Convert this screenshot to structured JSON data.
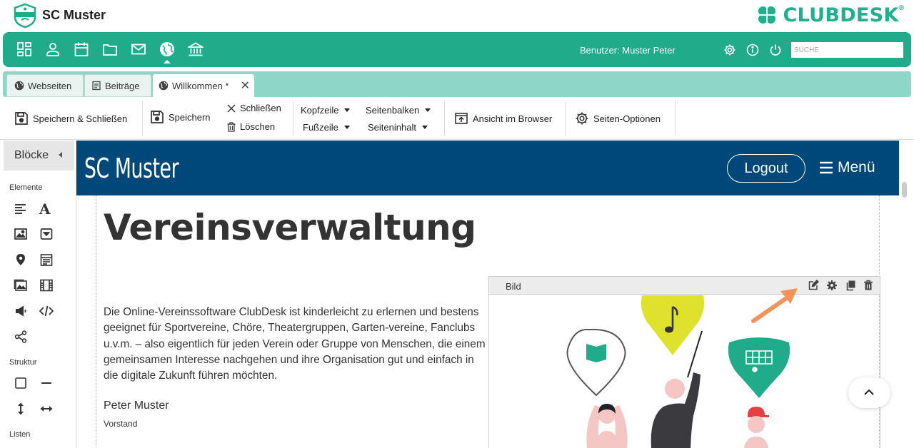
{
  "app": {
    "club_name": "SC Muster",
    "logo_text": "SC MUSTER",
    "brand_name": "CLUBDESK",
    "brand_reg": "®",
    "brand_color": "#20b08e"
  },
  "navbar": {
    "color": "#20ac8a",
    "icons": [
      "dashboard-icon",
      "person-icon",
      "calendar-icon",
      "folder-icon",
      "mail-icon",
      "globe-icon",
      "bank-icon"
    ],
    "active_icon": "globe-icon",
    "user_label": "Benutzer: Muster Peter",
    "right_icons": [
      "gear-icon",
      "info-icon",
      "power-icon"
    ],
    "search_placeholder": "SUCHE"
  },
  "tabs": [
    {
      "label": "Webseiten",
      "icon": "globe-icon",
      "active": false
    },
    {
      "label": "Beiträge",
      "icon": "document-icon",
      "active": false
    },
    {
      "label": "Willkommen *",
      "icon": "globe-icon",
      "active": true,
      "closable": true
    }
  ],
  "toolbar": {
    "save_close": "Speichern & Schließen",
    "save": "Speichern",
    "close": "Schließen",
    "delete": "Löschen",
    "header": "Kopfzeile",
    "footer": "Fußzeile",
    "sidebar": "Seitenbalken",
    "page_content": "Seiteninhalt",
    "view_browser": "Ansicht im Browser",
    "page_options": "Seiten-Optionen"
  },
  "sidebar": {
    "title": "Blöcke",
    "section_elements": "Elemente",
    "element_icons": [
      "text-align-icon",
      "font-icon",
      "image-icon",
      "dropdown-icon",
      "map-pin-icon",
      "calendar-list-icon",
      "gallery-icon",
      "film-icon",
      "megaphone-icon",
      "code-icon",
      "share-icon"
    ],
    "section_structure": "Struktur",
    "structure_icons": [
      "box-icon",
      "horizontal-line-icon",
      "vertical-spacer-icon",
      "horizontal-spacer-icon"
    ],
    "section_lists": "Listen"
  },
  "site": {
    "header_color": "#00477a",
    "title": "SC Muster",
    "logout": "Logout",
    "menu": "Menü",
    "heading": "Vereinsverwaltung",
    "intro": "Die Online-Vereinssoftware ClubDesk ist kinderleicht zu erlernen und bestens geeignet für Sportvereine, Chöre, Theatergruppen, Garten-vereine, Fanclubs u.v.m. – also eigentlich für jeden Verein oder Gruppe von Menschen, die einem gemeinsamen Interesse nachgehen und ihre Organisation gut und einfach in die digitale Zukunft führen möchten.",
    "author": "Peter Muster",
    "author_role": "Vorstand",
    "image_block_label": "Bild",
    "image_actions": [
      "edit-icon",
      "settings-icon",
      "copy-icon",
      "trash-icon"
    ]
  }
}
